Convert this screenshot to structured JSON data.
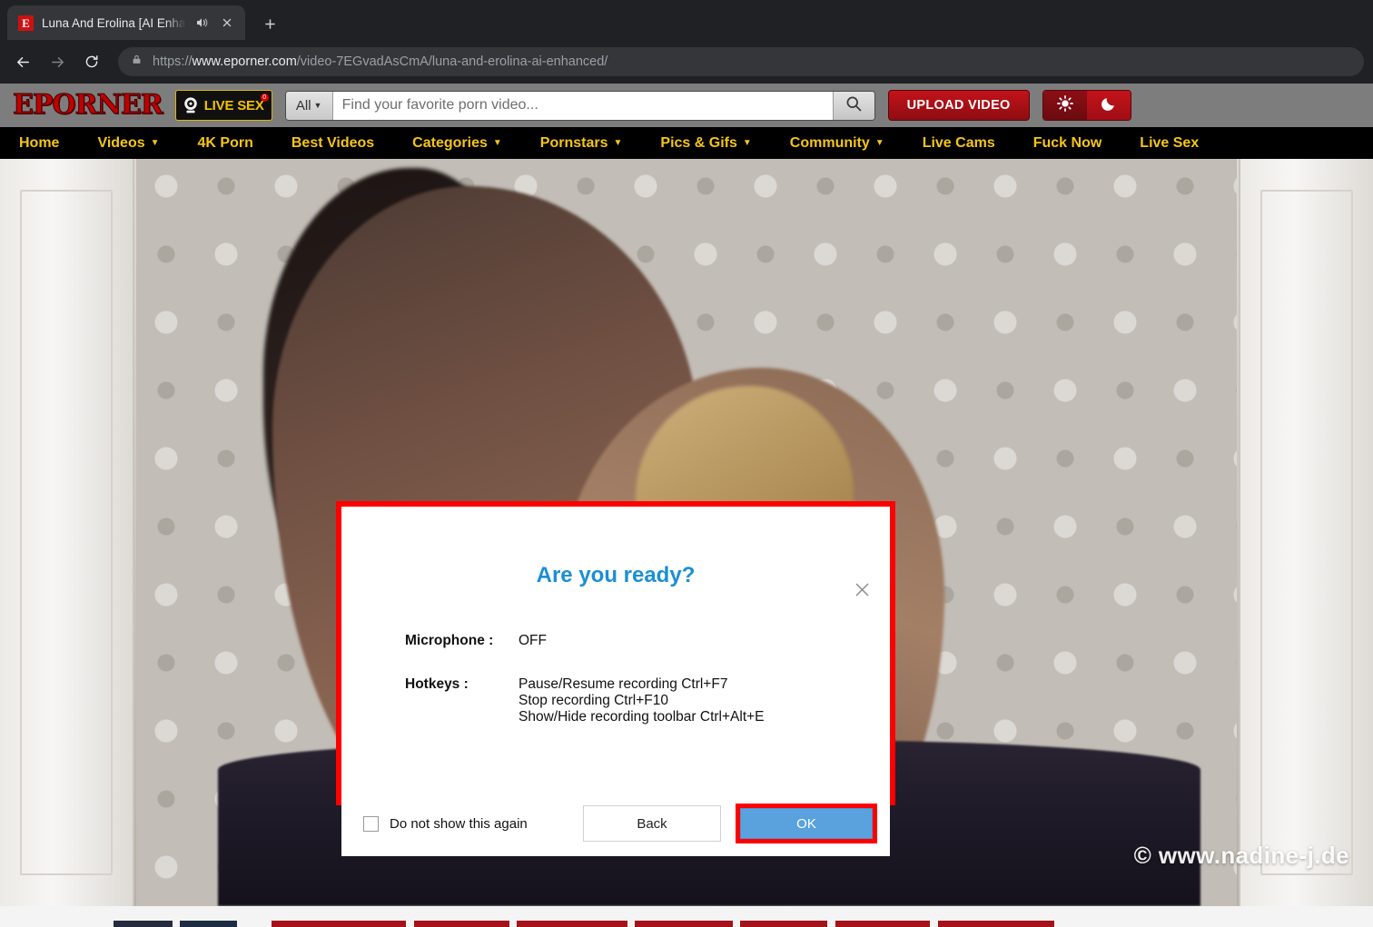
{
  "browser": {
    "tab": {
      "favicon_letter": "E",
      "title": "Luna And Erolina [AI Enhanced",
      "audio_icon": "speaker-icon",
      "close_icon": "close-icon"
    },
    "new_tab_icon": "plus-icon",
    "back_icon": "back-arrow-icon",
    "forward_icon": "forward-arrow-icon",
    "reload_icon": "reload-icon",
    "lock_icon": "lock-icon",
    "url": {
      "scheme": "https://",
      "host": "www.eporner.com",
      "path": "/video-7EGvadAsCmA/luna-and-erolina-ai-enhanced/",
      "full": "https://www.eporner.com/video-7EGvadAsCmA/luna-and-erolina-ai-enhanced/"
    }
  },
  "site": {
    "logo": "EPORNER",
    "live_sex_badge": {
      "label": "LIVE SEX",
      "icon": "webcam-icon",
      "badge_count": "0"
    },
    "search": {
      "scope": "All",
      "scope_caret": "▼",
      "placeholder": "Find your favorite porn video...",
      "value": "",
      "submit_icon": "search-icon"
    },
    "upload_label": "UPLOAD VIDEO",
    "theme": {
      "light_icon": "sun-icon",
      "dark_icon": "moon-icon",
      "active": "light"
    },
    "nav": [
      {
        "label": "Home",
        "has_dropdown": false,
        "caret": ""
      },
      {
        "label": "Videos",
        "has_dropdown": true,
        "caret": "▼"
      },
      {
        "label": "4K Porn",
        "has_dropdown": false,
        "caret": ""
      },
      {
        "label": "Best Videos",
        "has_dropdown": false,
        "caret": ""
      },
      {
        "label": "Categories",
        "has_dropdown": true,
        "caret": "▼"
      },
      {
        "label": "Pornstars",
        "has_dropdown": true,
        "caret": "▼"
      },
      {
        "label": "Pics & Gifs",
        "has_dropdown": true,
        "caret": "▼"
      },
      {
        "label": "Community",
        "has_dropdown": true,
        "caret": "▼"
      },
      {
        "label": "Live Cams",
        "has_dropdown": false,
        "caret": ""
      },
      {
        "label": "Fuck Now",
        "has_dropdown": false,
        "caret": ""
      },
      {
        "label": "Live Sex",
        "has_dropdown": false,
        "caret": ""
      }
    ],
    "player": {
      "watermark": "© www.nadine-j.de"
    }
  },
  "dialog": {
    "title": "Are you ready?",
    "close_icon": "close-icon",
    "rows": [
      {
        "label": "Microphone :",
        "value": "OFF"
      },
      {
        "label": "Hotkeys :",
        "value": "Pause/Resume recording Ctrl+F7\nStop recording Ctrl+F10\nShow/Hide recording toolbar Ctrl+Alt+E"
      }
    ],
    "checkbox_label": "Do not show this again",
    "checkbox_checked": false,
    "back_label": "Back",
    "ok_label": "OK",
    "highlight_color": "#ff0000",
    "title_color": "#1a8fd4",
    "ok_color": "#5aa2de"
  },
  "colors": {
    "browser_chrome": "#202124",
    "site_header": "#7d7d7d",
    "nav_bg": "#000000",
    "nav_text": "#f5c518",
    "brand_red": "#c4121a"
  }
}
